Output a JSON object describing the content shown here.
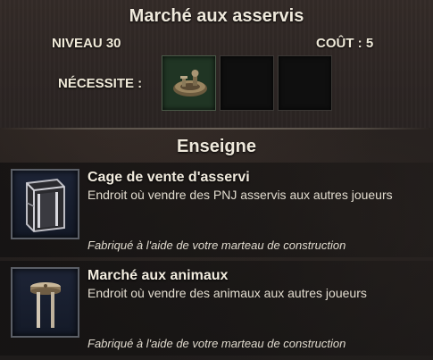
{
  "header": {
    "title": "Marché aux asservis",
    "level": "NIVEAU 30",
    "cost": "COÛT : 5",
    "requires_label": "NÉCESSITE :"
  },
  "requirements": [
    {
      "icon": "workbench-icon",
      "filled": true
    },
    {
      "icon": "empty-slot",
      "filled": false
    },
    {
      "icon": "empty-slot",
      "filled": false
    }
  ],
  "section": {
    "title": "Enseigne"
  },
  "items": [
    {
      "name": "Cage de vente d'asservi",
      "description": "Endroit où vendre des PNJ asservis aux autres joueurs",
      "crafted": "Fabriqué à l'aide de votre marteau de construction",
      "icon": "cage-icon"
    },
    {
      "name": "Marché aux animaux",
      "description": "Endroit où vendre des animaux aux autres joueurs",
      "crafted": "Fabriqué à l'aide de votre marteau de construction",
      "icon": "animal-post-icon"
    }
  ]
}
